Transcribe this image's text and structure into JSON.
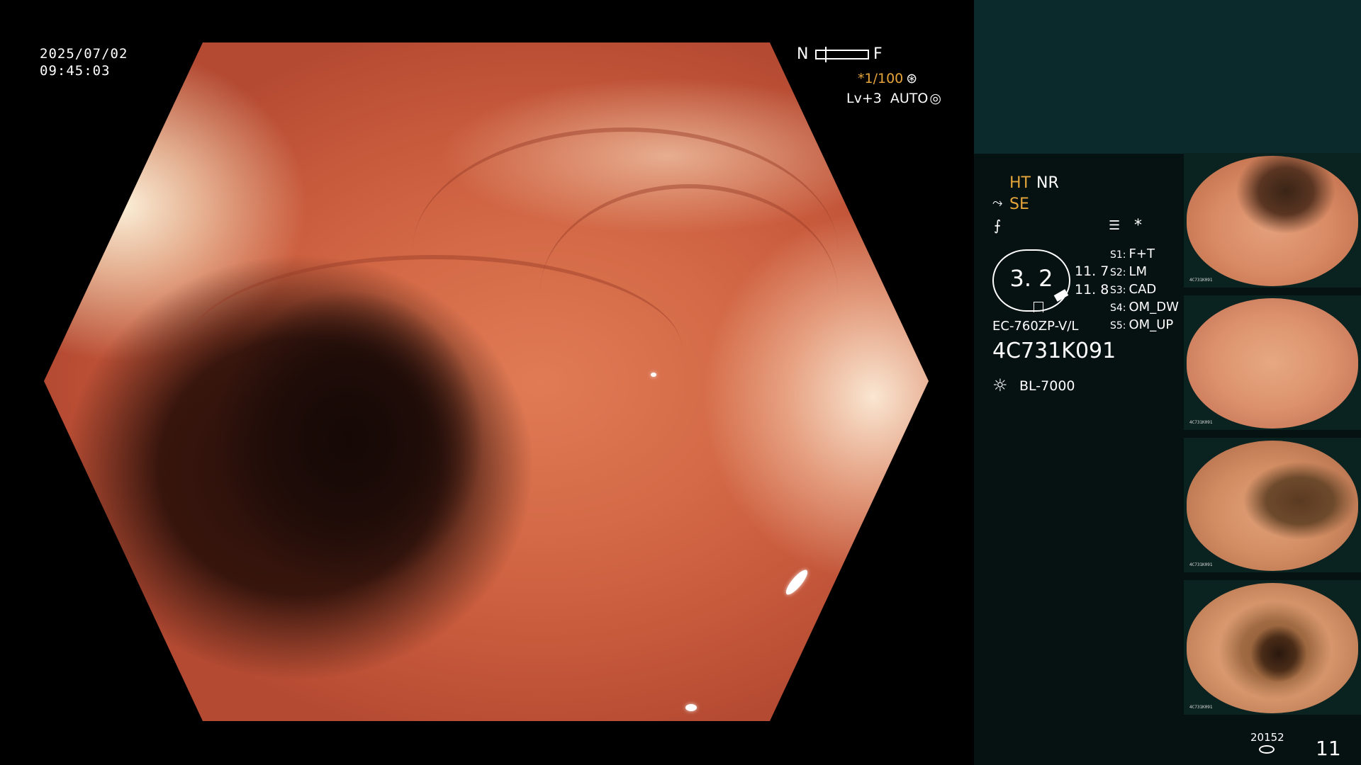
{
  "overlay": {
    "date": "2025/07/02",
    "time": "09:45:03",
    "nf_left": "N",
    "nf_right": "F",
    "zoom": "*1/100",
    "zoom_icon": "shutter-icon",
    "level": "Lv+3",
    "auto": "AUTO",
    "auto_icon": "iris-icon"
  },
  "side": {
    "ht": "HT",
    "nr": "NR",
    "se": "SE",
    "menu_icon": "menu-icon",
    "asterisk": "*",
    "gauge_value": "3. 2",
    "reading_1": "11. 7",
    "reading_2": "11. 8",
    "slots": [
      {
        "key": "S1:",
        "value": "F+T"
      },
      {
        "key": "S2:",
        "value": "LM"
      },
      {
        "key": "S3:",
        "value": "CAD"
      },
      {
        "key": "S4:",
        "value": "OM_DW"
      },
      {
        "key": "S5:",
        "value": "OM_UP"
      }
    ],
    "scope_model": "EC-760ZP-V/L",
    "scope_serial": "4C731K091",
    "light_source": "BL-7000",
    "light_icon": "light-source-icon",
    "storage_count": "20152",
    "image_count": "11"
  },
  "thumbnails": [
    {
      "caption": "4C731K091"
    },
    {
      "caption": "4C731K091"
    },
    {
      "caption": "4C731K091"
    },
    {
      "caption": "4C731K091"
    }
  ],
  "colors": {
    "accent_orange": "#e6a53a",
    "panel_dark": "#061211",
    "panel_teal": "#0b2a2c",
    "mucosa": "#d46a47"
  }
}
